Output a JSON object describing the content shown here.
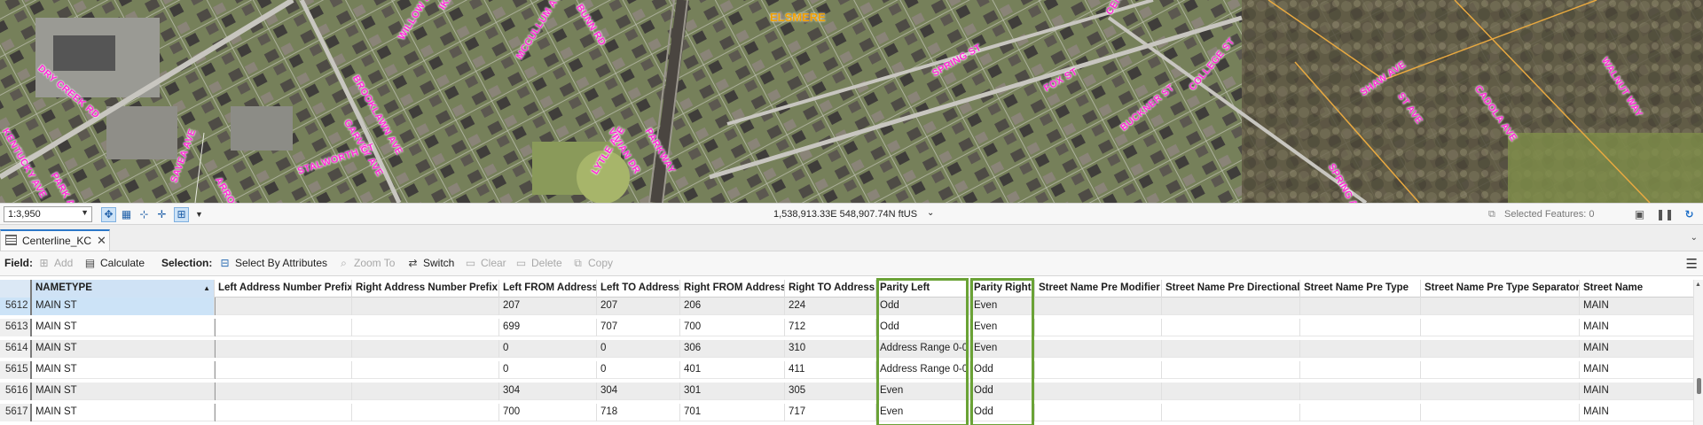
{
  "map": {
    "place_label": "ELSMERE",
    "street_labels": [
      "DRY CREEK RD",
      "WILLOW ST",
      "IKARD LN",
      "MCCULLUM AVE",
      "SPRING ST",
      "COLLEGE ST",
      "GARVEY AVE",
      "KENTUCKY AVE",
      "CENTRAL AVE",
      "PARK AVE",
      "SHAW AVE",
      "WALNUT WAY",
      "FOX ST",
      "BUCKNER ST",
      "SPRING AVE",
      "STALWORTH CT",
      "LYTLE AVE",
      "VIVIAN DR",
      "BROOKLAWN AVE",
      "PARKWAY",
      "SAVEA AVE",
      "ARROW ST",
      "CADOLA AVE",
      "ST AVE",
      "BUNN RD"
    ],
    "bg_color": "#6f7a55",
    "label_color": "#ff2bd6"
  },
  "statusbar": {
    "scale": "1:3,950",
    "coordinates": "1,538,913.33E 548,907.74N ftUS",
    "selected_features": "Selected Features: 0",
    "icons": [
      "pan-icon",
      "grid-icon",
      "snapping-icon",
      "crosshair-icon",
      "select-tool-icon",
      "chevron-down-icon"
    ]
  },
  "tab": {
    "label": "Centerline_KC",
    "close": "✕"
  },
  "toolbar": {
    "field_label": "Field:",
    "add": "Add",
    "calculate": "Calculate",
    "selection_label": "Selection:",
    "select_by_attributes": "Select By Attributes",
    "zoom_to": "Zoom To",
    "switch": "Switch",
    "clear": "Clear",
    "delete": "Delete",
    "copy": "Copy"
  },
  "table": {
    "columns": [
      "",
      "NAMETYPE",
      "Left Address Number Prefix",
      "Right Address Number Prefix",
      "Left FROM Address",
      "Left TO Address",
      "Right FROM Address",
      "Right TO Address",
      "Parity Left",
      "Parity Right",
      "Street Name Pre Modifier",
      "Street Name Pre Directional",
      "Street Name Pre Type",
      "Street Name Pre Type Separator",
      "Street Name"
    ],
    "rows": [
      [
        "5612",
        "MAIN ST",
        "",
        "",
        "207",
        "207",
        "206",
        "224",
        "Odd",
        "Even",
        "",
        "",
        "",
        "",
        "MAIN"
      ],
      [
        "5613",
        "MAIN ST",
        "",
        "",
        "699",
        "707",
        "700",
        "712",
        "Odd",
        "Even",
        "",
        "",
        "",
        "",
        "MAIN"
      ],
      [
        "5614",
        "MAIN ST",
        "",
        "",
        "0",
        "0",
        "306",
        "310",
        "Address Range 0-0",
        "Even",
        "",
        "",
        "",
        "",
        "MAIN"
      ],
      [
        "5615",
        "MAIN ST",
        "",
        "",
        "0",
        "0",
        "401",
        "411",
        "Address Range 0-0",
        "Odd",
        "",
        "",
        "",
        "",
        "MAIN"
      ],
      [
        "5616",
        "MAIN ST",
        "",
        "",
        "304",
        "304",
        "301",
        "305",
        "Even",
        "Odd",
        "",
        "",
        "",
        "",
        "MAIN"
      ],
      [
        "5617",
        "MAIN ST",
        "",
        "",
        "700",
        "718",
        "701",
        "717",
        "Even",
        "Odd",
        "",
        "",
        "",
        "",
        "MAIN"
      ]
    ],
    "highlight_color": "#6aa236",
    "selected_row_color": "#cce3f7"
  }
}
